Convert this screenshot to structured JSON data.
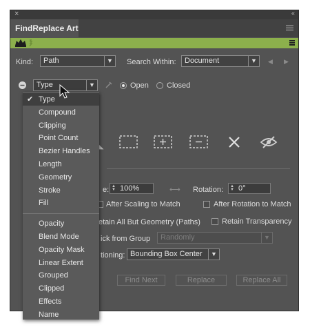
{
  "window": {
    "close_glyph": "×",
    "collapse_glyph": "‹‹"
  },
  "panel": {
    "tab_title": "FindReplace Art"
  },
  "kind": {
    "label": "Kind:",
    "value": "Path"
  },
  "search_within": {
    "label": "Search Within:",
    "value": "Document"
  },
  "type_select": {
    "value": "Type"
  },
  "radios": {
    "open": "Open",
    "closed": "Closed"
  },
  "scale": {
    "label_partial": "e:",
    "value": "100%"
  },
  "rotation": {
    "label": "Rotation:",
    "value": "0°"
  },
  "checks": {
    "after_scaling": "After Scaling to Match",
    "after_rotation": "After Rotation to Match",
    "retain_geometry": "etain All But Geometry (Paths)",
    "retain_transparency": "Retain Transparency"
  },
  "pick_from_group": {
    "label_partial": "ick from Group",
    "value": "Randomly"
  },
  "positioning": {
    "label_partial": "tioning:",
    "value": "Bounding Box Center"
  },
  "buttons": {
    "find_next": "Find Next",
    "replace": "Replace",
    "replace_all": "Replace All"
  },
  "menu": {
    "group1": [
      "Type",
      "Compound",
      "Clipping",
      "Point Count",
      "Bezier Handles",
      "Length",
      "Geometry",
      "Stroke",
      "Fill"
    ],
    "group2": [
      "Opacity",
      "Blend Mode",
      "Opacity Mask",
      "Linear Extent",
      "Grouped",
      "Clipped",
      "Effects",
      "Name"
    ],
    "selected": "Type",
    "checkmark": "✔"
  },
  "colors": {
    "panel_bg": "#535353",
    "accent_green": "#8cb04c",
    "tab_bar": "#424242"
  },
  "icons": [
    "close-icon",
    "collapse-icon",
    "hamburger-menu-icon",
    "crown-icon",
    "minus-circle-icon",
    "eyedropper-icon",
    "select-rect-icon",
    "select-add-icon",
    "select-subtract-icon",
    "x-icon",
    "hidden-eye-icon",
    "link-icon",
    "mouse-cursor-icon"
  ]
}
